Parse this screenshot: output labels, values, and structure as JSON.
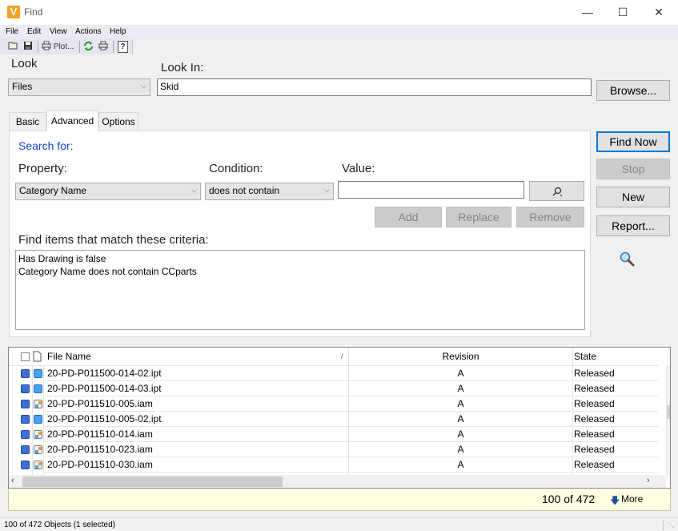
{
  "window": {
    "title": "Find",
    "app_icon_letter": "V",
    "minimize": "—",
    "maximize": "☐",
    "close": "✕"
  },
  "menu": [
    "File",
    "Edit",
    "View",
    "Actions",
    "Help"
  ],
  "toolbar": {
    "plot_label": "Plot...",
    "help_label": "?"
  },
  "look": {
    "label": "Look",
    "value": "Files"
  },
  "look_in": {
    "label": "Look In:",
    "value": "Skid",
    "browse": "Browse..."
  },
  "tabs": [
    "Basic",
    "Advanced",
    "Options"
  ],
  "advanced": {
    "search_for": "Search for:",
    "property_label": "Property:",
    "condition_label": "Condition:",
    "value_label": "Value:",
    "property_value": "Category Name",
    "condition_value": "does not contain",
    "value_input": "",
    "add": "Add",
    "replace": "Replace",
    "remove": "Remove",
    "criteria_label": "Find items that match these criteria:",
    "criteria": [
      "Has Drawing is false",
      "Category Name does not contain CCparts"
    ]
  },
  "right_buttons": {
    "find_now": "Find Now",
    "stop": "Stop",
    "new": "New",
    "report": "Report..."
  },
  "grid": {
    "columns": {
      "file_name": "File Name",
      "sort_mark": "/",
      "revision": "Revision",
      "state": "State"
    },
    "rows": [
      {
        "file": "20-PD-P011500-014-02.ipt",
        "revision": "A",
        "state": "Released",
        "type": "part"
      },
      {
        "file": "20-PD-P011500-014-03.ipt",
        "revision": "A",
        "state": "Released",
        "type": "part"
      },
      {
        "file": "20-PD-P011510-005.iam",
        "revision": "A",
        "state": "Released",
        "type": "assembly"
      },
      {
        "file": "20-PD-P011510-005-02.ipt",
        "revision": "A",
        "state": "Released",
        "type": "part"
      },
      {
        "file": "20-PD-P011510-014.iam",
        "revision": "A",
        "state": "Released",
        "type": "assembly"
      },
      {
        "file": "20-PD-P011510-023.iam",
        "revision": "A",
        "state": "Released",
        "type": "assembly"
      },
      {
        "file": "20-PD-P011510-030.iam",
        "revision": "A",
        "state": "Released",
        "type": "assembly"
      }
    ]
  },
  "results": {
    "count": "100 of 472",
    "more": "More"
  },
  "status": "100 of 472 Objects (1 selected)",
  "colors": {
    "accent": "#0078d7",
    "search_for": "#1a3fd6"
  }
}
